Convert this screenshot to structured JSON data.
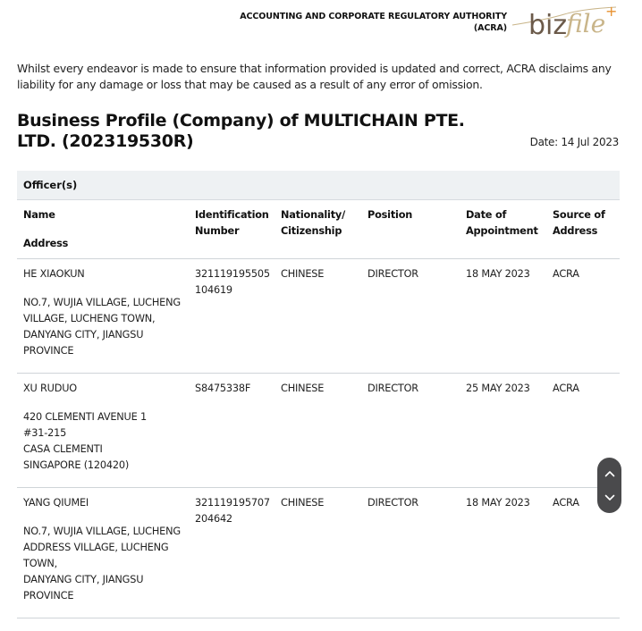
{
  "header": {
    "authority_line1": "ACCOUNTING AND CORPORATE REGULATORY AUTHORITY",
    "authority_line2": "(ACRA)",
    "logo_text_main": "biz",
    "logo_text_script": "file",
    "logo_plus": "+",
    "logo_colors": {
      "main": "#6b5a4a",
      "script": "#c9b58a",
      "plus": "#e8912f"
    }
  },
  "disclaimer": "Whilst every endeavor is made to ensure that information provided is updated and correct, ACRA disclaims any liability for any damage or loss that may be caused as a result of any error of omission.",
  "profile": {
    "title": "Business Profile (Company) of MULTICHAIN PTE. LTD. (202319530R)",
    "date": "Date: 14 Jul 2023"
  },
  "officers": {
    "section_title": "Officer(s)",
    "columns": {
      "name": "Name",
      "address": "Address",
      "id": "Identification Number",
      "nationality": "Nationality/ Citizenship",
      "position": "Position",
      "date": "Date of Appointment",
      "source": "Source of Address"
    },
    "rows": [
      {
        "name": "HE XIAOKUN",
        "address": [
          "NO.7, WUJIA VILLAGE, LUCHENG VILLAGE, LUCHENG TOWN,",
          "DANYANG CITY, JIANGSU PROVINCE"
        ],
        "id": "321119195505104619",
        "nationality": "CHINESE",
        "position": "DIRECTOR",
        "date": "18 MAY 2023",
        "source": "ACRA"
      },
      {
        "name": "XU RUDUO",
        "address": [
          "420 CLEMENTI AVENUE 1",
          "#31-215",
          "CASA CLEMENTI",
          "SINGAPORE (120420)"
        ],
        "id": "S8475338F",
        "nationality": "CHINESE",
        "position": "DIRECTOR",
        "date": "25 MAY 2023",
        "source": "ACRA"
      },
      {
        "name": "YANG QIUMEI",
        "address": [
          "NO.7, WUJIA VILLAGE, LUCHENG ADDRESS VILLAGE, LUCHENG TOWN,",
          "DANYANG CITY, JIANGSU PROVINCE"
        ],
        "id": "321119195707204642",
        "nationality": "CHINESE",
        "position": "DIRECTOR",
        "date": "18 MAY 2023",
        "source": "ACRA"
      }
    ]
  },
  "scroll_control": {
    "up_icon": "chevron-up",
    "down_icon": "chevron-down",
    "color": "#4a4a4c"
  }
}
